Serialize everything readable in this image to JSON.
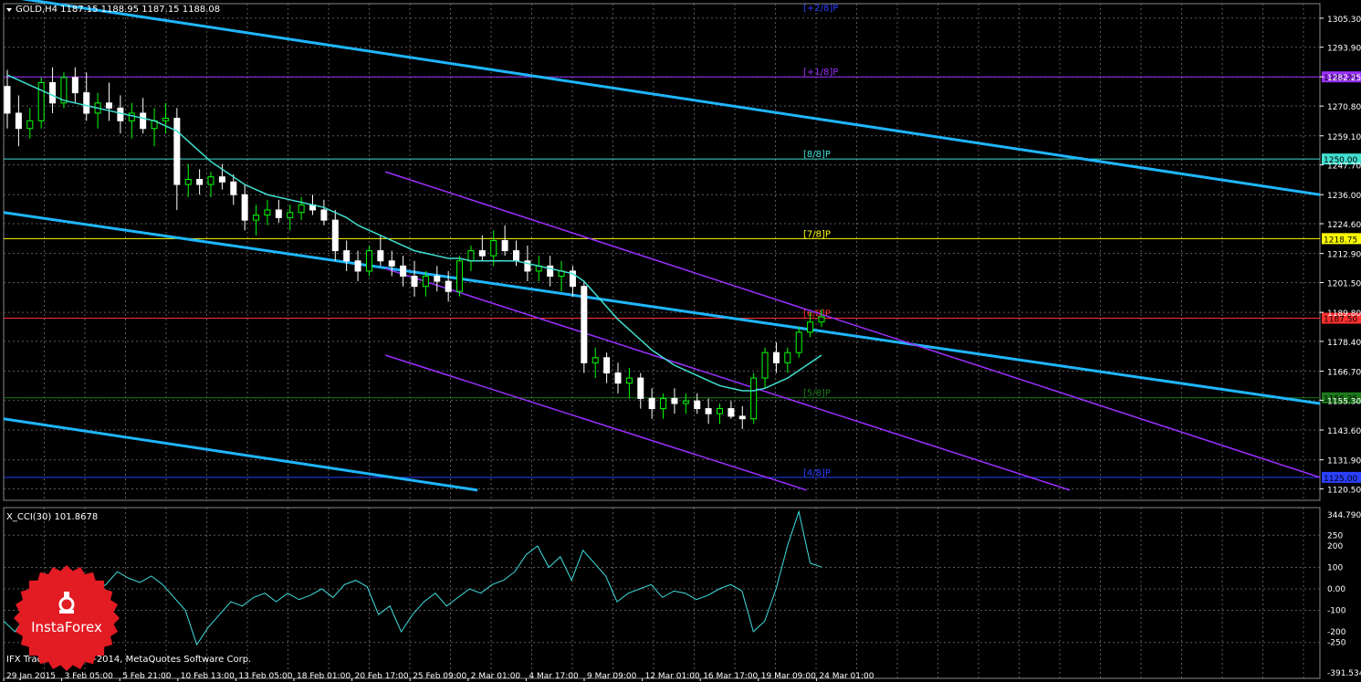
{
  "header": {
    "symbol_label": "GOLD,H4  1187.15 1188.95 1187.15 1188.08"
  },
  "footer": {
    "copyright": "IFX Trader, © 2001-2014, MetaQuotes Software Corp."
  },
  "logo": {
    "text": "InstaForex"
  },
  "colors": {
    "background": "#000000",
    "grid": "#5a5a5a",
    "candle_up": "#00ff00",
    "candle_down": "#ffffff",
    "ma": "#40e0d0",
    "trend": "#1fb6ff",
    "channel": "#9b30ff",
    "cci": "#40e0e0",
    "logo": "#e31b23"
  },
  "chart_data": [
    {
      "type": "candlestick",
      "symbol": "GOLD",
      "timeframe": "H4",
      "ylim": [
        1116.0,
        1311.0
      ],
      "grid": true,
      "y_ticks": [
        "1305.30",
        "1293.90",
        "1282.25",
        "1270.80",
        "1259.10",
        "1247.70",
        "1236.00",
        "1224.60",
        "1212.90",
        "1201.50",
        "1189.80",
        "1178.40",
        "1166.70",
        "1155.30",
        "1143.60",
        "1131.90",
        "1120.50"
      ],
      "x_ticks": [
        "29 Jan 2015",
        "3 Feb 05:00",
        "5 Feb 21:00",
        "10 Feb 13:00",
        "13 Feb 05:00",
        "18 Feb 01:00",
        "20 Feb 17:00",
        "25 Feb 09:00",
        "2 Mar 01:00",
        "4 Mar 17:00",
        "9 Mar 09:00",
        "12 Mar 01:00",
        "16 Mar 17:00",
        "19 Mar 09:00",
        "24 Mar 01:00"
      ],
      "price_levels": [
        {
          "price": 1282.25,
          "label": "1282.25",
          "murrey": "[+1/8]P",
          "color": "#9b30ff"
        },
        {
          "price": 1250.0,
          "label": "1250.00",
          "murrey": "[8/8]P",
          "color": "#40e0d0"
        },
        {
          "price": 1218.75,
          "label": "1218.75",
          "murrey": "[7/8]P",
          "color": "#ffff00"
        },
        {
          "price": 1187.5,
          "label": "1187.50",
          "murrey": "[6/8]P",
          "color": "#ff3030"
        },
        {
          "price": 1156.25,
          "label": "1156.25",
          "murrey": "[5/8]P",
          "color": "#1a7a1a"
        },
        {
          "price": 1125.0,
          "label": "1125.00",
          "murrey": "[4/8]P",
          "color": "#2a40ff"
        },
        {
          "price": 1313.5,
          "label": "",
          "murrey": "[+2/8]P",
          "color": "#2a40ff"
        }
      ],
      "candles": [
        [
          1278.5,
          1285.0,
          1262.0,
          1268.0
        ],
        [
          1268.0,
          1275.0,
          1255.0,
          1262.0
        ],
        [
          1262.0,
          1270.0,
          1258.0,
          1265.0
        ],
        [
          1265.0,
          1282.0,
          1262.0,
          1280.0
        ],
        [
          1280.0,
          1286.0,
          1268.0,
          1272.0
        ],
        [
          1272.0,
          1284.0,
          1270.0,
          1282.0
        ],
        [
          1282.0,
          1286.0,
          1272.0,
          1276.0
        ],
        [
          1276.0,
          1284.0,
          1265.0,
          1268.0
        ],
        [
          1268.0,
          1276.0,
          1262.0,
          1272.0
        ],
        [
          1272.0,
          1280.0,
          1265.0,
          1270.0
        ],
        [
          1270.0,
          1275.0,
          1260.0,
          1265.0
        ],
        [
          1265.0,
          1272.0,
          1258.0,
          1268.0
        ],
        [
          1268.0,
          1274.0,
          1260.0,
          1262.0
        ],
        [
          1262.0,
          1270.0,
          1255.0,
          1265.0
        ],
        [
          1265.0,
          1272.0,
          1260.0,
          1266.0
        ],
        [
          1266.0,
          1270.0,
          1230.0,
          1240.0
        ],
        [
          1240.0,
          1248.0,
          1235.0,
          1242.0
        ],
        [
          1242.0,
          1246.0,
          1236.0,
          1240.0
        ],
        [
          1240.0,
          1245.0,
          1235.0,
          1243.0
        ],
        [
          1243.0,
          1248.0,
          1238.0,
          1241.0
        ],
        [
          1241.0,
          1244.0,
          1232.0,
          1236.0
        ],
        [
          1236.0,
          1240.0,
          1222.0,
          1226.0
        ],
        [
          1226.0,
          1232.0,
          1220.0,
          1228.0
        ],
        [
          1228.0,
          1234.0,
          1224.0,
          1230.0
        ],
        [
          1230.0,
          1234.0,
          1225.0,
          1227.0
        ],
        [
          1227.0,
          1232.0,
          1222.0,
          1229.0
        ],
        [
          1229.0,
          1235.0,
          1226.0,
          1232.0
        ],
        [
          1232.0,
          1236.0,
          1228.0,
          1230.0
        ],
        [
          1230.0,
          1234.0,
          1224.0,
          1226.0
        ],
        [
          1226.0,
          1230.0,
          1210.0,
          1214.0
        ],
        [
          1214.0,
          1218.0,
          1206.0,
          1210.0
        ],
        [
          1210.0,
          1214.0,
          1202.0,
          1206.0
        ],
        [
          1206.0,
          1216.0,
          1204.0,
          1214.0
        ],
        [
          1214.0,
          1220.0,
          1208.0,
          1210.0
        ],
        [
          1210.0,
          1214.0,
          1204.0,
          1208.0
        ],
        [
          1208.0,
          1212.0,
          1200.0,
          1204.0
        ],
        [
          1204.0,
          1210.0,
          1196.0,
          1200.0
        ],
        [
          1200.0,
          1206.0,
          1196.0,
          1204.0
        ],
        [
          1204.0,
          1208.0,
          1198.0,
          1202.0
        ],
        [
          1202.0,
          1206.0,
          1194.0,
          1198.0
        ],
        [
          1198.0,
          1212.0,
          1196.0,
          1210.0
        ],
        [
          1210.0,
          1216.0,
          1206.0,
          1214.0
        ],
        [
          1214.0,
          1220.0,
          1210.0,
          1212.0
        ],
        [
          1212.0,
          1222.0,
          1208.0,
          1218.0
        ],
        [
          1218.0,
          1224.0,
          1212.0,
          1214.0
        ],
        [
          1214.0,
          1218.0,
          1208.0,
          1210.0
        ],
        [
          1210.0,
          1216.0,
          1202.0,
          1206.0
        ],
        [
          1206.0,
          1212.0,
          1202.0,
          1208.0
        ],
        [
          1208.0,
          1212.0,
          1200.0,
          1204.0
        ],
        [
          1204.0,
          1210.0,
          1198.0,
          1206.0
        ],
        [
          1206.0,
          1208.0,
          1196.0,
          1200.0
        ],
        [
          1200.0,
          1202.0,
          1166.0,
          1170.0
        ],
        [
          1170.0,
          1176.0,
          1164.0,
          1172.0
        ],
        [
          1172.0,
          1174.0,
          1162.0,
          1166.0
        ],
        [
          1166.0,
          1170.0,
          1158.0,
          1162.0
        ],
        [
          1162.0,
          1168.0,
          1156.0,
          1164.0
        ],
        [
          1164.0,
          1166.0,
          1152.0,
          1156.0
        ],
        [
          1156.0,
          1160.0,
          1148.0,
          1152.0
        ],
        [
          1152.0,
          1158.0,
          1148.0,
          1156.0
        ],
        [
          1156.0,
          1160.0,
          1150.0,
          1154.0
        ],
        [
          1154.0,
          1158.0,
          1150.0,
          1155.0
        ],
        [
          1155.0,
          1158.0,
          1150.0,
          1152.0
        ],
        [
          1152.0,
          1156.0,
          1146.0,
          1150.0
        ],
        [
          1150.0,
          1154.0,
          1146.0,
          1152.0
        ],
        [
          1152.0,
          1155.0,
          1148.0,
          1149.0
        ],
        [
          1149.0,
          1153.0,
          1144.0,
          1148.0
        ],
        [
          1148.0,
          1166.0,
          1146.0,
          1164.0
        ],
        [
          1164.0,
          1176.0,
          1160.0,
          1174.0
        ],
        [
          1174.0,
          1178.0,
          1166.0,
          1170.0
        ],
        [
          1170.0,
          1176.0,
          1166.0,
          1174.0
        ],
        [
          1174.0,
          1184.0,
          1172.0,
          1182.0
        ],
        [
          1182.0,
          1190.0,
          1180.0,
          1186.0
        ],
        [
          1186.0,
          1191.0,
          1184.0,
          1188.0
        ]
      ],
      "ma": [
        1283,
        1281,
        1279,
        1277,
        1275,
        1273,
        1272,
        1271,
        1270,
        1269,
        1268,
        1267,
        1266,
        1265,
        1263,
        1261,
        1257,
        1253,
        1249,
        1246,
        1243,
        1240,
        1238,
        1236,
        1235,
        1234,
        1233,
        1232,
        1231,
        1229,
        1227,
        1224,
        1222,
        1220,
        1218,
        1216,
        1214,
        1213,
        1212,
        1211,
        1211,
        1210,
        1210,
        1210,
        1210,
        1210,
        1209,
        1208,
        1207,
        1206,
        1205,
        1202,
        1197,
        1192,
        1187,
        1183,
        1179,
        1175,
        1172,
        1169,
        1167,
        1165,
        1163,
        1161,
        1160,
        1159,
        1159,
        1160,
        1162,
        1164,
        1167,
        1170,
        1173
      ],
      "lines": [
        {
          "kind": "trend",
          "from": [
            0,
            1314.0
          ],
          "to": [
            1,
            1236.0
          ]
        },
        {
          "kind": "trend",
          "from": [
            0,
            1229.0
          ],
          "to": [
            1,
            1154.0
          ]
        },
        {
          "kind": "trend",
          "from": [
            0,
            1148.0
          ],
          "to": [
            0.36,
            1120.0
          ]
        },
        {
          "kind": "channel",
          "from": [
            0.29,
            1245.0
          ],
          "to": [
            1,
            1125.0
          ]
        },
        {
          "kind": "channel",
          "from": [
            0.29,
            1207.0
          ],
          "to": [
            0.81,
            1120.0
          ]
        },
        {
          "kind": "channel",
          "from": [
            0.29,
            1173.0
          ],
          "to": [
            0.61,
            1120.0
          ]
        }
      ]
    },
    {
      "type": "line",
      "indicator": "X_CCI(30)",
      "title": "X_CCI(30) 101.8678",
      "ylim": [
        -391.534,
        344.7903
      ],
      "y_ticks": [
        "344.7903",
        "250",
        "200",
        "100",
        "0.00",
        "-100",
        "-200",
        "-250",
        "-391.534"
      ],
      "values": [
        -150,
        -200,
        -120,
        -60,
        -20,
        10,
        40,
        60,
        -10,
        20,
        80,
        50,
        30,
        60,
        20,
        -40,
        -100,
        -260,
        -180,
        -120,
        -60,
        -80,
        -40,
        -20,
        -60,
        -20,
        -50,
        -30,
        0,
        -40,
        20,
        40,
        10,
        -120,
        -80,
        -200,
        -120,
        -60,
        -20,
        -80,
        -40,
        0,
        -20,
        20,
        40,
        80,
        160,
        200,
        100,
        150,
        40,
        180,
        120,
        60,
        -60,
        -20,
        0,
        20,
        -40,
        -10,
        -20,
        -50,
        -30,
        0,
        20,
        -10,
        -200,
        -150,
        0,
        200,
        360,
        120,
        101.8678
      ],
      "color": "#40e0e0"
    }
  ]
}
